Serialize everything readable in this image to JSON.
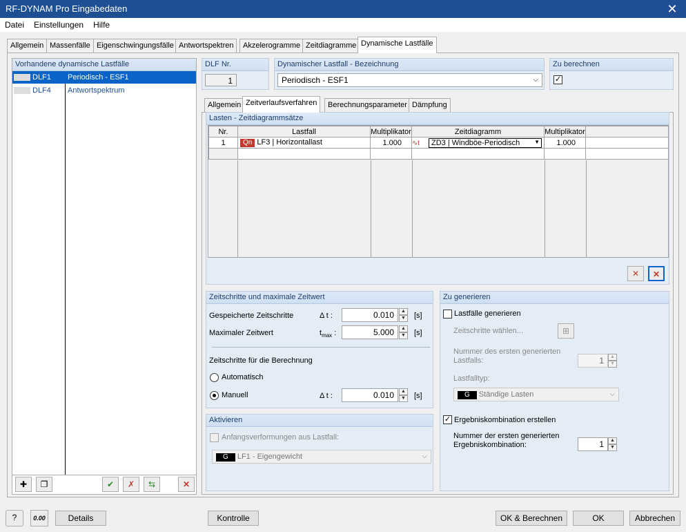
{
  "window": {
    "title": "RF-DYNAM Pro Eingabedaten"
  },
  "menu": [
    "Datei",
    "Einstellungen",
    "Hilfe"
  ],
  "tabs": [
    "Allgemein",
    "Massenfälle",
    "Eigenschwingungsfälle",
    "Antwortspektren",
    "Akzelerogramme",
    "Zeitdiagramme",
    "Dynamische Lastfälle"
  ],
  "left_panel": {
    "title": "Vorhandene dynamische Lastfälle",
    "items": [
      {
        "id": "DLF1",
        "name": "Periodisch - ESF1",
        "selected": true
      },
      {
        "id": "DLF4",
        "name": "Antwortspektrum",
        "selected": false
      }
    ]
  },
  "dlf_nr": {
    "title": "DLF Nr.",
    "value": "1"
  },
  "bezeichnung": {
    "title": "Dynamischer Lastfall - Bezeichnung",
    "value": "Periodisch - ESF1"
  },
  "zu_berechnen": {
    "title": "Zu berechnen",
    "checked": true,
    "check": "✓"
  },
  "subtabs": [
    "Allgemein",
    "Zeitverlaufsverfahren",
    "Berechnungsparameter",
    "Dämpfung"
  ],
  "lasten": {
    "title": "Lasten - Zeitdiagrammsätze",
    "columns": [
      "Nr.",
      "Lastfall",
      "Multiplikator",
      "Zeitdiagramm",
      "Multiplikator"
    ],
    "rows": [
      {
        "nr": "1",
        "badge": "Qn",
        "lastfall": "LF3 | Horizontallast",
        "mult1": "1.000",
        "diagram": "ZD3 | Windböe-Periodisch",
        "mult2": "1.000"
      }
    ]
  },
  "zeitschritte": {
    "title": "Zeitschritte und maximale Zeitwert",
    "gespeichert_label": "Gespeicherte Zeitschritte",
    "gespeichert_sym": "Δ t :",
    "gespeichert_value": "0.010",
    "max_label": "Maximaler Zeitwert",
    "max_sym_main": "t",
    "max_sym_sub": "max",
    "max_sym_colon": " :",
    "max_value": "5.000",
    "unit": "[s]",
    "berechnung_label": "Zeitschritte für die Berechnung",
    "automatisch": "Automatisch",
    "manuell": "Manuell",
    "manuell_sym": "Δ t :",
    "manuell_value": "0.010",
    "selected": "manuell"
  },
  "aktivieren": {
    "title": "Aktivieren",
    "anfangs_label": "Anfangsverformungen aus Lastfall:",
    "badge": "G",
    "value": "LF1 - Eigengewicht"
  },
  "zu_generieren": {
    "title": "Zu generieren",
    "lastfaelle_label": "Lastfälle generieren",
    "lastfaelle_checked": false,
    "zeitschritte_label": "Zeitschritte wählen...",
    "nummer_label": "Nummer des ersten generierten",
    "nummer_label2": "Lastfalls:",
    "nummer_value": "1",
    "lastfalltyp_label": "Lastfalltyp:",
    "lastfalltyp_badge": "G",
    "lastfalltyp_value": "Ständige Lasten",
    "kombi_label": "Ergebniskombination erstellen",
    "kombi_checked": true,
    "kombi_check": "✓",
    "kombi_nummer_label": "Nummer der ersten generierten",
    "kombi_nummer_label2": "Ergebniskombination:",
    "kombi_nummer_value": "1"
  },
  "footer": {
    "calc_icon_text": "0.00",
    "details": "Details",
    "kontrolle": "Kontrolle",
    "ok_berechnen": "OK & Berechnen",
    "ok": "OK",
    "abbrechen": "Abbrechen"
  },
  "colors": {
    "titlebar": "#1e4f93",
    "selection": "#0a64c8",
    "accent_red": "#c0392b"
  }
}
